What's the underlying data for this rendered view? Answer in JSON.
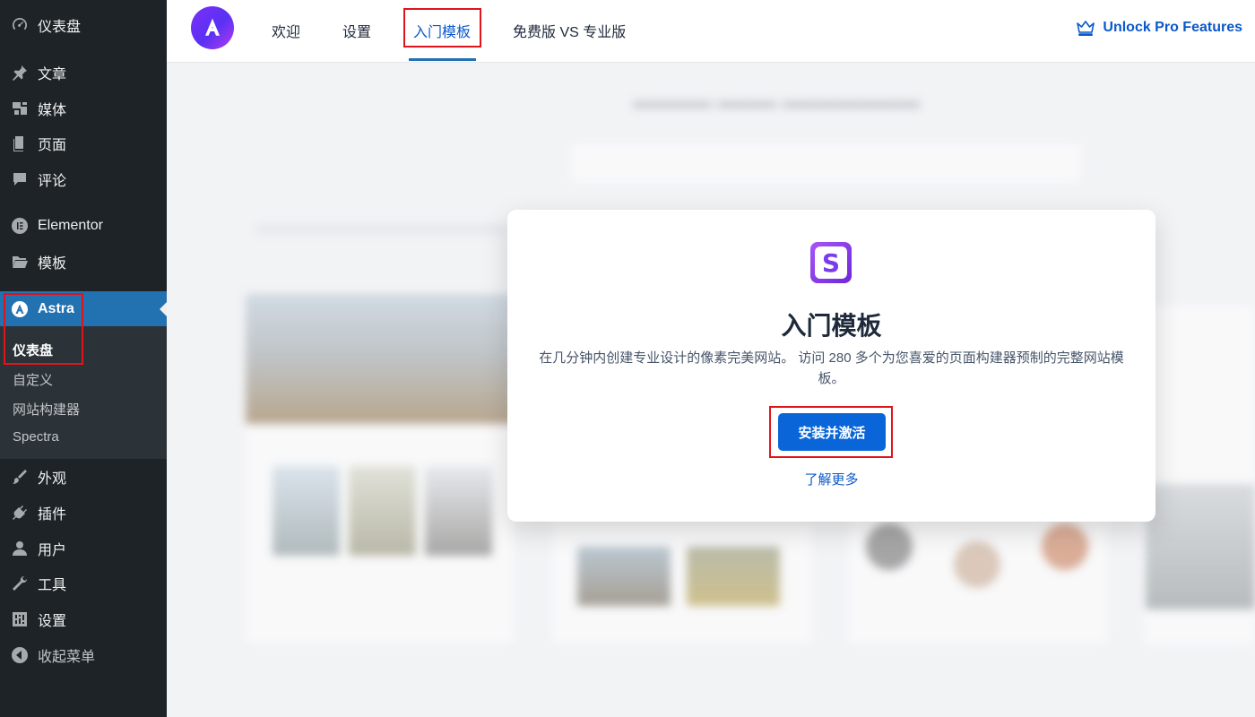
{
  "sidebar": {
    "items": [
      {
        "label": "仪表盘",
        "icon": "dashboard-icon"
      },
      {
        "label": "文章",
        "icon": "pin-icon"
      },
      {
        "label": "媒体",
        "icon": "media-icon"
      },
      {
        "label": "页面",
        "icon": "page-icon"
      },
      {
        "label": "评论",
        "icon": "comment-icon"
      },
      {
        "label": "Elementor",
        "icon": "elementor-icon"
      },
      {
        "label": "模板",
        "icon": "folder-icon"
      },
      {
        "label": "Astra",
        "icon": "astra-icon"
      },
      {
        "label": "外观",
        "icon": "brush-icon"
      },
      {
        "label": "插件",
        "icon": "plugin-icon"
      },
      {
        "label": "用户",
        "icon": "user-icon"
      },
      {
        "label": "工具",
        "icon": "wrench-icon"
      },
      {
        "label": "设置",
        "icon": "settings-icon"
      },
      {
        "label": "收起菜单",
        "icon": "collapse-icon"
      }
    ],
    "submenu": [
      "仪表盘",
      "自定义",
      "网站构建器",
      "Spectra"
    ]
  },
  "topnav": {
    "tabs": [
      "欢迎",
      "设置",
      "入门模板",
      "免费版 VS 专业版"
    ],
    "active_tab": "入门模板",
    "unlock_label": "Unlock Pro Features"
  },
  "modal": {
    "logo": "spectra-logo",
    "title": "入门模板",
    "description": "在几分钟内创建专业设计的像素完美网站。 访问 280 多个为您喜爱的页面构建器预制的完整网站模板。",
    "install_label": "安装并激活",
    "learn_more_label": "了解更多"
  },
  "colors": {
    "sidebar_bg": "#1d2327",
    "sidebar_active": "#2271b1",
    "accent": "#0a66d8",
    "highlight_box": "#e0141b"
  }
}
